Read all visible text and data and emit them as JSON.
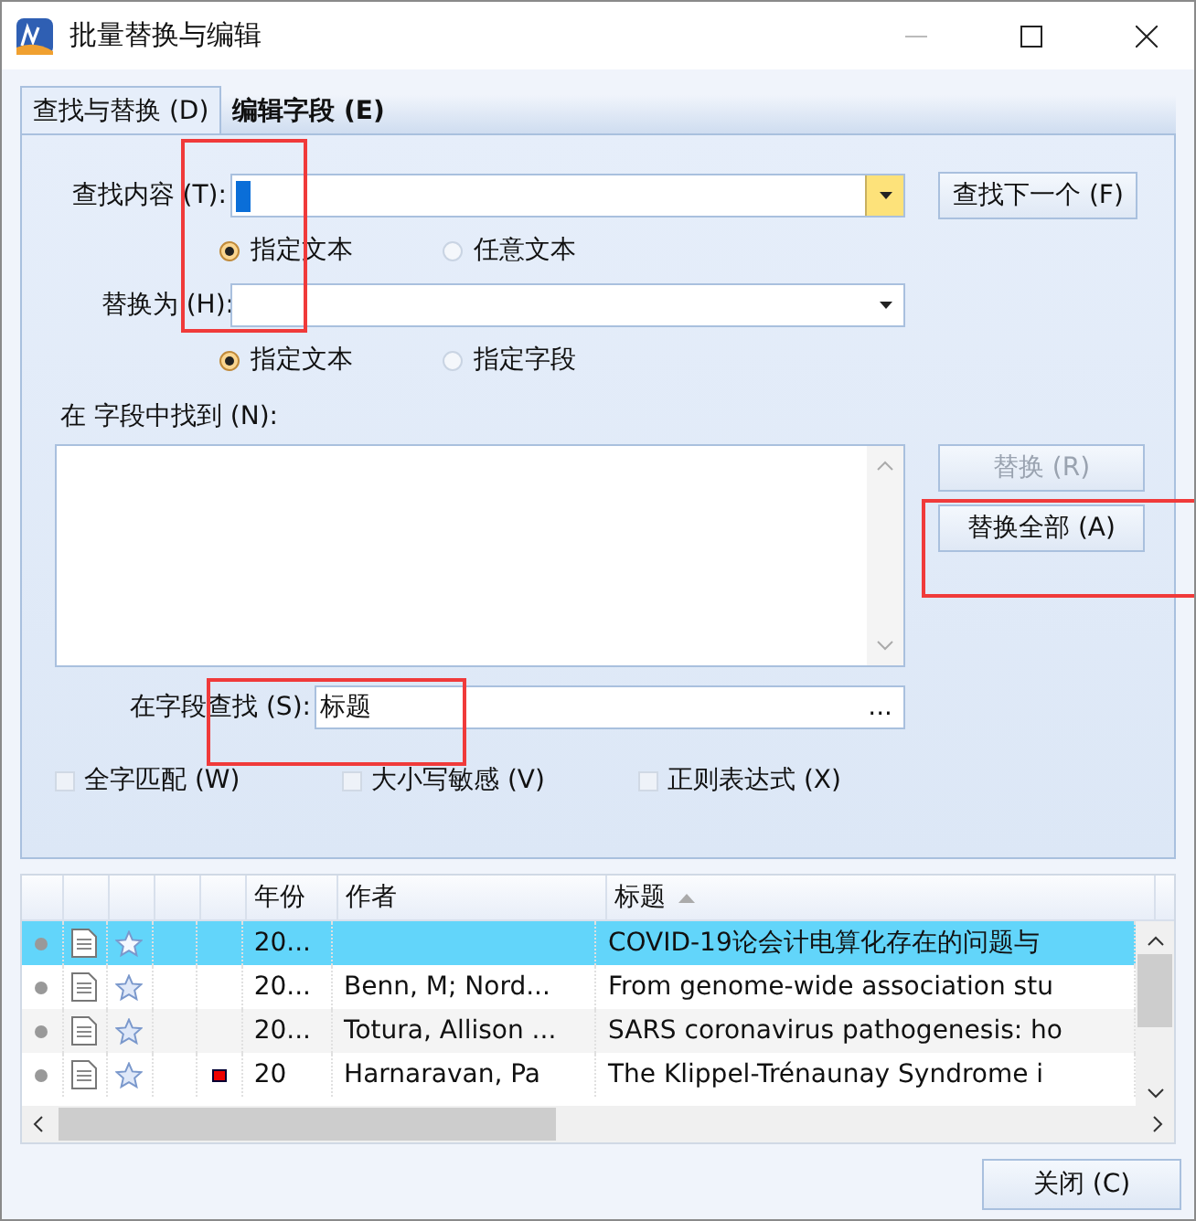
{
  "window": {
    "title": "批量替换与编辑"
  },
  "tabs": [
    {
      "label": "查找与替换 (D)",
      "selected": true
    },
    {
      "label": "编辑字段 (E)",
      "selected": false
    }
  ],
  "find": {
    "label": "查找内容 (T):",
    "focused": true,
    "options": [
      {
        "label": "指定文本",
        "selected": true
      },
      {
        "label": "任意文本",
        "selected": false
      }
    ]
  },
  "replace": {
    "label": "替换为 (H):",
    "options": [
      {
        "label": "指定文本",
        "selected": true
      },
      {
        "label": "指定字段",
        "selected": false
      }
    ]
  },
  "found_label": "在  字段中找到 (N):",
  "field_search": {
    "label": "在字段查找 (S):",
    "value": "标题",
    "browse": "..."
  },
  "checkboxes": [
    {
      "label": "全字匹配 (W)",
      "checked": false
    },
    {
      "label": "大小写敏感 (V)",
      "checked": false
    },
    {
      "label": "正则表达式 (X)",
      "checked": false
    }
  ],
  "buttons": [
    {
      "label": "查找下一个 (F)",
      "disabled": false
    },
    {
      "label": "替换 (R)",
      "disabled": true
    },
    {
      "label": "替换全部 (A)",
      "disabled": false
    }
  ],
  "table": {
    "columns": [
      {
        "label": "年份"
      },
      {
        "label": "作者"
      },
      {
        "label": "标题",
        "sorted_ascending": true
      }
    ],
    "rows": [
      {
        "selected": true,
        "flagged": false,
        "year": "20...",
        "author": "",
        "title": "COVID-19论会计电算化存在的问题与"
      },
      {
        "selected": false,
        "flagged": false,
        "year": "20...",
        "author": "Benn, M; Nord...",
        "title": "From genome-wide association stu"
      },
      {
        "selected": false,
        "flagged": false,
        "year": "20...",
        "author": "Totura, Allison ...",
        "title": "SARS coronavirus pathogenesis: ho"
      },
      {
        "selected": false,
        "flagged": true,
        "year": "20",
        "author": "Harnaravan, Pa",
        "title": "The Klippel-Trénaunay Syndrome i"
      }
    ]
  },
  "close_button": {
    "label": "关闭 (C)"
  }
}
